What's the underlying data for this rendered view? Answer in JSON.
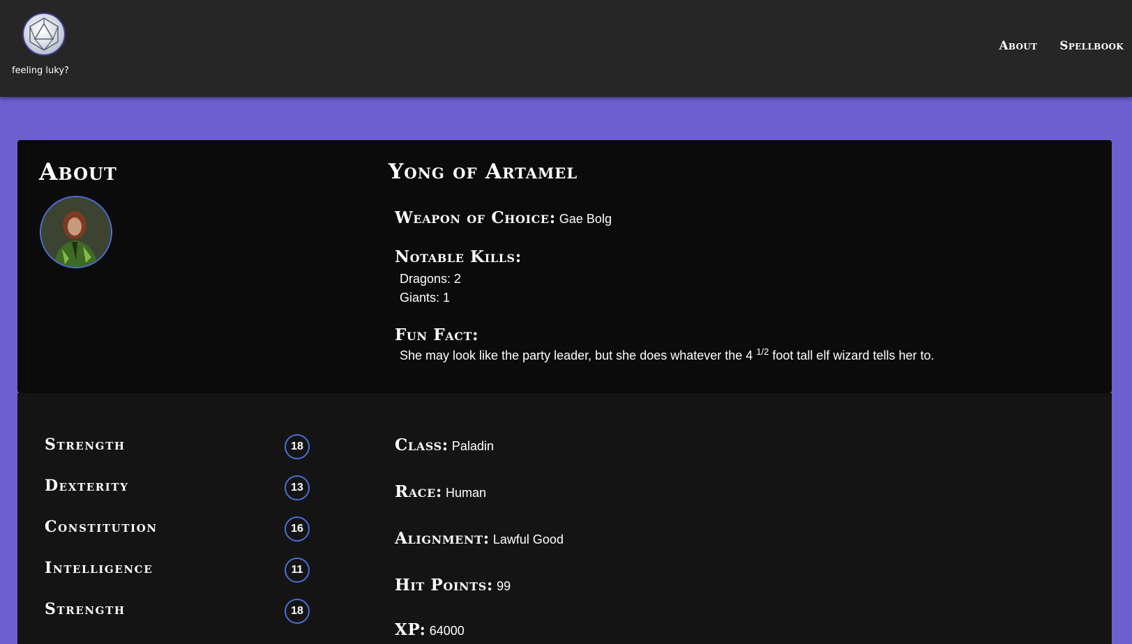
{
  "header": {
    "logo_caption": "feeling luky?",
    "nav": [
      "About",
      "Spellbook"
    ]
  },
  "about": {
    "title": "About",
    "name": "Yong of Artamel",
    "weapon_label": "Weapon of Choice:",
    "weapon": "Gae Bolg",
    "kills_label": "Notable Kills:",
    "kills": [
      "Dragons: 2",
      "Giants: 1"
    ],
    "fact_label": "Fun Fact:",
    "fact_before": "She may look like the party leader, but she does whatever the 4 ",
    "fact_sup": "1/2",
    "fact_after": " foot tall elf wizard tells her to."
  },
  "stats": [
    {
      "name": "Strength",
      "value": "18"
    },
    {
      "name": "Dexterity",
      "value": "13"
    },
    {
      "name": "Constitution",
      "value": "16"
    },
    {
      "name": "Intelligence",
      "value": "11"
    },
    {
      "name": "Strength",
      "value": "18"
    }
  ],
  "details": {
    "class_label": "Class:",
    "class": "Paladin",
    "race_label": "Race:",
    "race": "Human",
    "alignment_label": "Alignment:",
    "alignment": "Lawful Good",
    "hp_label": "Hit Points:",
    "hp": "99",
    "xp_label": "XP:",
    "xp": "64000"
  },
  "colors": {
    "accent": "#6e5fd0",
    "badge_border": "#4a6fd8",
    "header_bg": "#262626"
  }
}
